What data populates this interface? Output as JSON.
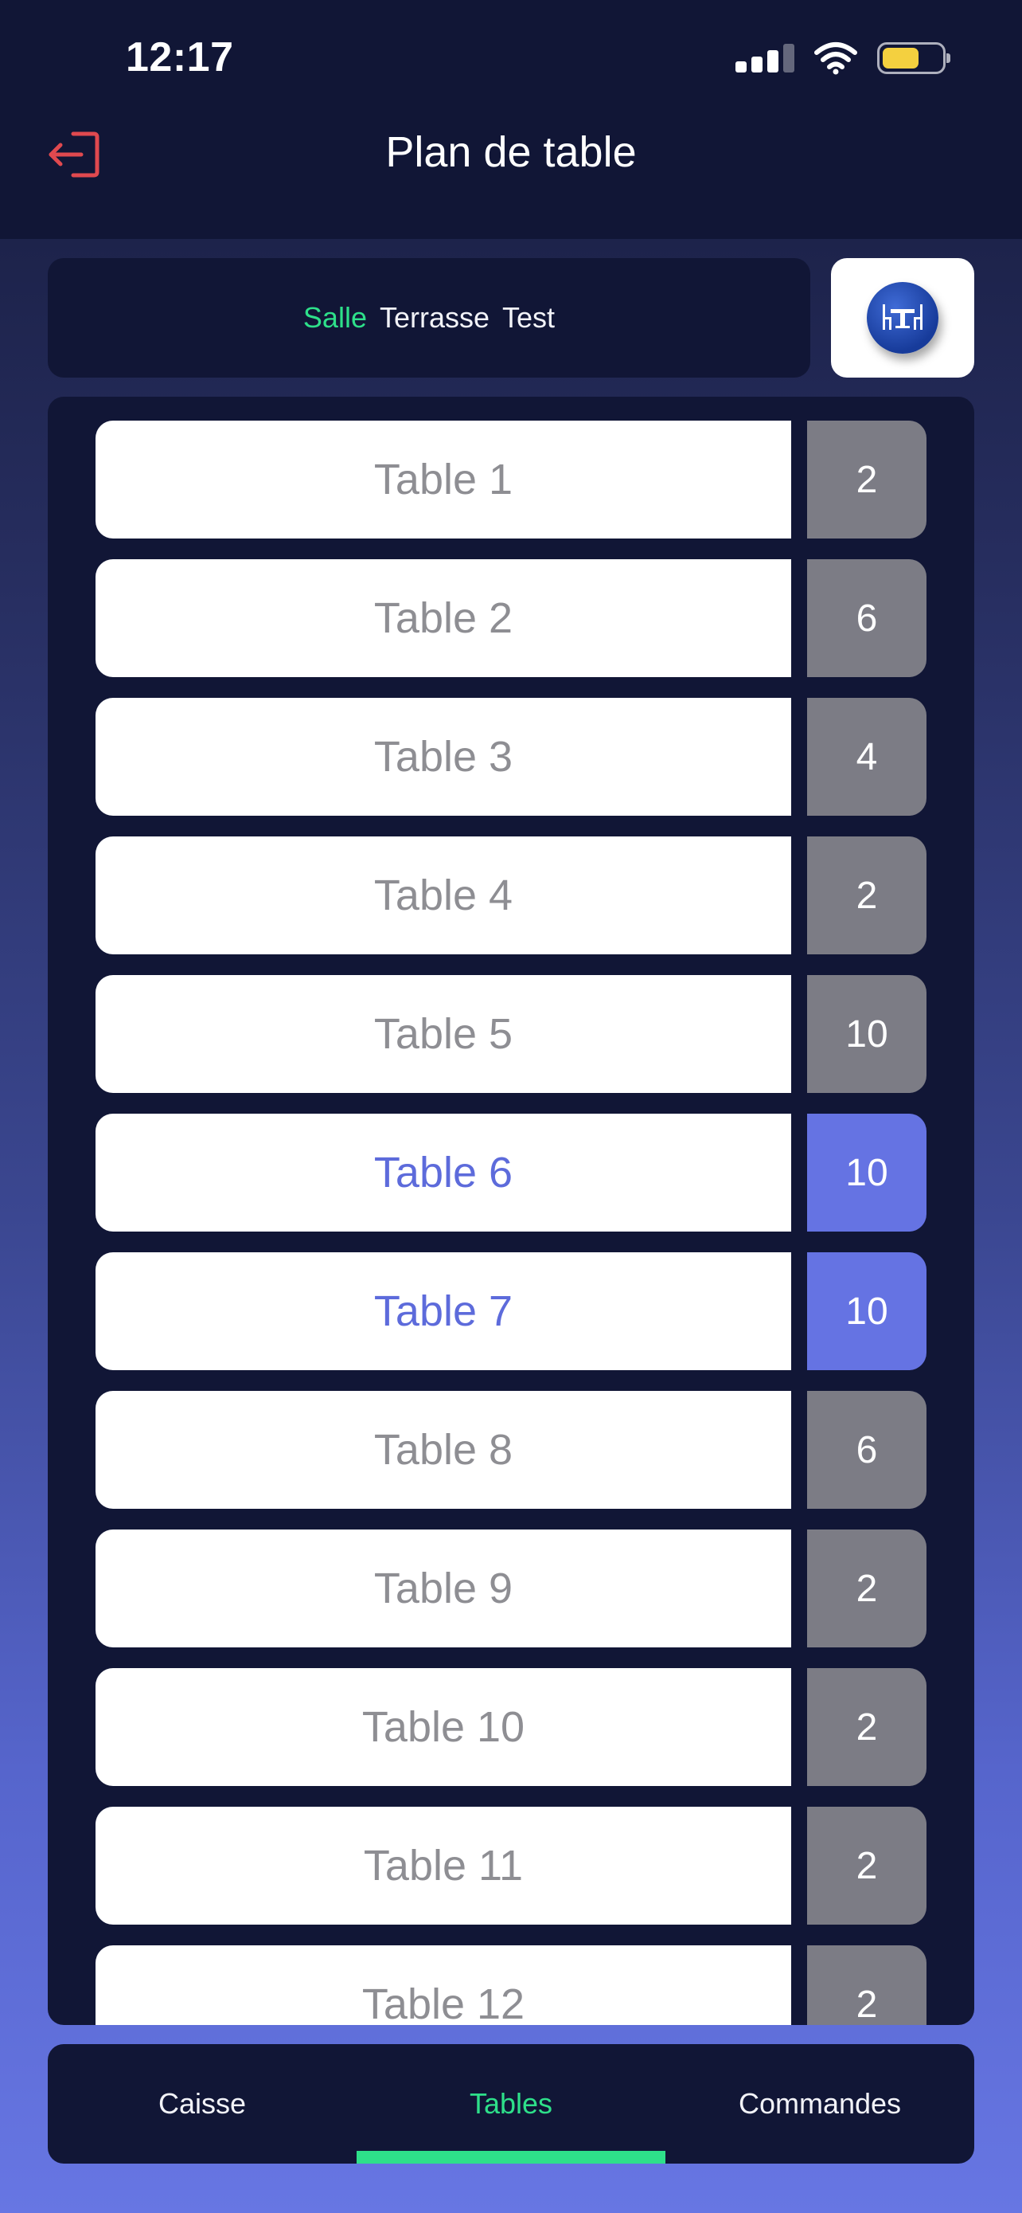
{
  "status_bar": {
    "time": "12:17"
  },
  "header": {
    "title": "Plan de table",
    "logout_icon": "logout-icon"
  },
  "rooms": {
    "tabs": [
      {
        "label": "Salle",
        "active": true
      },
      {
        "label": "Terrasse",
        "active": false
      },
      {
        "label": "Test",
        "active": false
      }
    ],
    "active_color": "#2ee08a"
  },
  "tables": [
    {
      "name": "Table 1",
      "seats": "2",
      "selected": false
    },
    {
      "name": "Table 2",
      "seats": "6",
      "selected": false
    },
    {
      "name": "Table 3",
      "seats": "4",
      "selected": false
    },
    {
      "name": "Table 4",
      "seats": "2",
      "selected": false
    },
    {
      "name": "Table 5",
      "seats": "10",
      "selected": false
    },
    {
      "name": "Table 6",
      "seats": "10",
      "selected": true
    },
    {
      "name": "Table 7",
      "seats": "10",
      "selected": true
    },
    {
      "name": "Table 8",
      "seats": "6",
      "selected": false
    },
    {
      "name": "Table 9",
      "seats": "2",
      "selected": false
    },
    {
      "name": "Table 10",
      "seats": "2",
      "selected": false
    },
    {
      "name": "Table 11",
      "seats": "2",
      "selected": false
    },
    {
      "name": "Table 12",
      "seats": "2",
      "selected": false
    }
  ],
  "colors": {
    "selected": "#6573e3",
    "seats_default": "#7c7c85",
    "accent_green": "#2ee08a",
    "logout_red": "#e0494f"
  },
  "bottom_nav": {
    "tabs": [
      {
        "label": "Caisse",
        "active": false
      },
      {
        "label": "Tables",
        "active": true
      },
      {
        "label": "Commandes",
        "active": false
      }
    ]
  }
}
